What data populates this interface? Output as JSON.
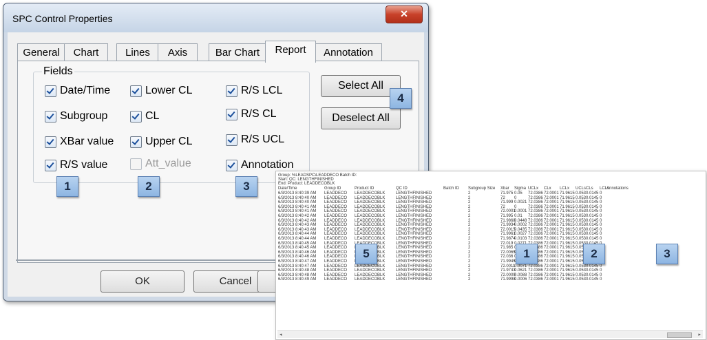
{
  "window": {
    "title": "SPC Control Properties",
    "close_glyph": "✕"
  },
  "tabs": [
    "General",
    "Chart",
    "Lines",
    "Axis",
    "Bar Chart",
    "Report",
    "Annotation"
  ],
  "active_tab": "Report",
  "fields_group": {
    "title": "Fields",
    "checkboxes": [
      {
        "label": "Date/Time",
        "checked": true,
        "enabled": true
      },
      {
        "label": "Subgroup",
        "checked": true,
        "enabled": true
      },
      {
        "label": "XBar value",
        "checked": true,
        "enabled": true
      },
      {
        "label": "R/S value",
        "checked": true,
        "enabled": true
      },
      {
        "label": "Lower CL",
        "checked": true,
        "enabled": true
      },
      {
        "label": "CL",
        "checked": true,
        "enabled": true
      },
      {
        "label": "Upper CL",
        "checked": true,
        "enabled": true
      },
      {
        "label": "Att_value",
        "checked": false,
        "enabled": false
      },
      {
        "label": "R/S LCL",
        "checked": true,
        "enabled": true
      },
      {
        "label": "R/S CL",
        "checked": true,
        "enabled": true
      },
      {
        "label": "R/S UCL",
        "checked": true,
        "enabled": true
      },
      {
        "label": "Annotation",
        "checked": true,
        "enabled": true
      }
    ]
  },
  "buttons": {
    "select_all": "Select All",
    "deselect_all": "Deselect All",
    "ok": "OK",
    "cancel": "Cancel"
  },
  "badges": [
    "1",
    "2",
    "3",
    "4",
    "5",
    "1",
    "2",
    "3"
  ],
  "report": {
    "header_lines": [
      "Group: %LEADSPC\\LEADDECO  Batch ID:",
      "Start:                              QC: LENGTHFINISHED",
      "End:                                Product: LEADDECOBLK"
    ],
    "columns": [
      "Date/Time",
      "Group ID",
      "Product ID",
      "QC ID",
      "Batch ID",
      "Subgroup Size",
      "Xbar",
      "Sigma",
      "UCLx",
      "CLx",
      "LCLx",
      "UCLs",
      "CLs",
      "LCLs",
      "Annotations"
    ],
    "rows": [
      [
        "6/3/2013 8:40:39 AM",
        "LEADDECO",
        "LEADDECOBLK",
        "LENGTHFINISHED",
        "",
        "2",
        "71.975",
        "0.05",
        "72.0386",
        "72.0001",
        "71.9615",
        "0.053",
        "0.0145",
        "0",
        ""
      ],
      [
        "6/3/2013 8:40:40 AM",
        "LEADDECO",
        "LEADDECOBLK",
        "LENGTHFINISHED",
        "",
        "2",
        "72",
        "0",
        "72.0386",
        "72.0001",
        "71.9615",
        "0.053",
        "0.0145",
        "0",
        ""
      ],
      [
        "6/3/2013 8:40:40 AM",
        "LEADDECO",
        "LEADDECOBLK",
        "LENGTHFINISHED",
        "",
        "2",
        "71.999",
        "0.0021",
        "72.0386",
        "72.0001",
        "71.9615",
        "0.053",
        "0.0145",
        "0",
        ""
      ],
      [
        "6/3/2013 8:40:41 AM",
        "LEADDECO",
        "LEADDECOBLK",
        "LENGTHFINISHED",
        "",
        "2",
        "72",
        "0",
        "72.0386",
        "72.0001",
        "71.9615",
        "0.053",
        "0.0145",
        "0",
        ""
      ],
      [
        "6/3/2013 8:40:41 AM",
        "LEADDECO",
        "LEADDECOBLK",
        "LENGTHFINISHED",
        "",
        "2",
        "72.0001",
        "0.0001",
        "72.0386",
        "72.0001",
        "71.9615",
        "0.053",
        "0.0145",
        "0",
        ""
      ],
      [
        "6/3/2013 8:40:42 AM",
        "LEADDECO",
        "LEADDECOBLK",
        "LENGTHFINISHED",
        "",
        "2",
        "71.995",
        "0.01",
        "72.0386",
        "72.0001",
        "71.9615",
        "0.053",
        "0.0145",
        "0",
        ""
      ],
      [
        "6/3/2013 8:40:42 AM",
        "LEADDECO",
        "LEADDECOBLK",
        "LENGTHFINISHED",
        "",
        "2",
        "71.9868",
        "0.0448",
        "72.0386",
        "72.0001",
        "71.9615",
        "0.053",
        "0.0145",
        "0",
        ""
      ],
      [
        "6/3/2013 8:40:43 AM",
        "LEADDECO",
        "LEADDECOBLK",
        "LENGTHFINISHED",
        "",
        "2",
        "71.9934",
        "0.0002",
        "72.0386",
        "72.0001",
        "71.9615",
        "0.053",
        "0.0145",
        "0",
        ""
      ],
      [
        "6/3/2013 8:40:43 AM",
        "LEADDECO",
        "LEADDECOBLK",
        "LENGTHFINISHED",
        "",
        "2",
        "72.0015",
        "0.0435",
        "72.0386",
        "72.0001",
        "71.9615",
        "0.053",
        "0.0145",
        "0",
        ""
      ],
      [
        "6/3/2013 8:40:44 AM",
        "LEADDECO",
        "LEADDECOBLK",
        "LENGTHFINISHED",
        "",
        "2",
        "71.9961",
        "0.0027",
        "72.0386",
        "72.0001",
        "71.9615",
        "0.053",
        "0.0145",
        "0",
        ""
      ],
      [
        "6/3/2013 8:40:44 AM",
        "LEADDECO",
        "LEADDECOBLK",
        "LENGTHFINISHED",
        "",
        "2",
        "71.9874",
        "0.0103",
        "72.0386",
        "72.0001",
        "71.9615",
        "0.053",
        "0.0145",
        "0",
        ""
      ],
      [
        "6/3/2013 8:40:45 AM",
        "LEADDECO",
        "LEADDECOBLK",
        "LENGTHFINISHED",
        "",
        "2",
        "72.019",
        "0.0271",
        "72.0386",
        "72.0001",
        "71.9615",
        "0.053",
        "0.0145",
        "0",
        ""
      ],
      [
        "6/3/2013 8:40:45 AM",
        "LEADDECO",
        "LEADDECOBLK",
        "LENGTHFINISHED",
        "",
        "2",
        "71.985",
        "0.035",
        "72.0386",
        "72.0001",
        "71.9615",
        "0.053",
        "0.0145",
        "0",
        ""
      ],
      [
        "6/3/2013 8:40:46 AM",
        "LEADDECO",
        "LEADDECOBLK",
        "LENGTHFINISHED",
        "",
        "2",
        "72.0065",
        "0.004",
        "72.0386",
        "72.0001",
        "71.9615",
        "0.053",
        "0.0145",
        "0",
        ""
      ],
      [
        "6/3/2013 8:40:46 AM",
        "LEADDECO",
        "LEADDECOBLK",
        "LENGTHFINISHED",
        "",
        "2",
        "72.036",
        "0.099",
        "72.0386",
        "72.0001",
        "71.9615",
        "0.053",
        "0.0145",
        "0",
        ""
      ],
      [
        "6/3/2013 8:40:47 AM",
        "LEADDECO",
        "LEADDECOBLK",
        "LENGTHFINISHED",
        "",
        "2",
        "71.9945",
        "0.006",
        "72.0386",
        "72.0001",
        "71.9615",
        "0.053",
        "0.0145",
        "0",
        ""
      ],
      [
        "6/3/2013 8:40:47 AM",
        "LEADDECO",
        "LEADDECOBLK",
        "LENGTHFINISHED",
        "",
        "2",
        "72.0011",
        "0.0071",
        "72.0386",
        "72.0001",
        "71.9615",
        "0.053",
        "0.0145",
        "0",
        ""
      ],
      [
        "6/3/2013 8:40:48 AM",
        "LEADDECO",
        "LEADDECOBLK",
        "LENGTHFINISHED",
        "",
        "2",
        "71.9743",
        "0.0621",
        "72.0386",
        "72.0001",
        "71.9615",
        "0.053",
        "0.0145",
        "0",
        ""
      ],
      [
        "6/3/2013 8:40:48 AM",
        "LEADDECO",
        "LEADDECOBLK",
        "LENGTHFINISHED",
        "",
        "2",
        "72.0009",
        "0.0088",
        "72.0386",
        "72.0001",
        "71.9615",
        "0.053",
        "0.0145",
        "0",
        ""
      ],
      [
        "6/3/2013 8:40:49 AM",
        "LEADDECO",
        "LEADDECOBLK",
        "LENGTHFINISHED",
        "",
        "2",
        "71.9998",
        "0.0006",
        "72.0386",
        "72.0001",
        "71.9615",
        "0.053",
        "0.0145",
        "0",
        ""
      ]
    ]
  }
}
